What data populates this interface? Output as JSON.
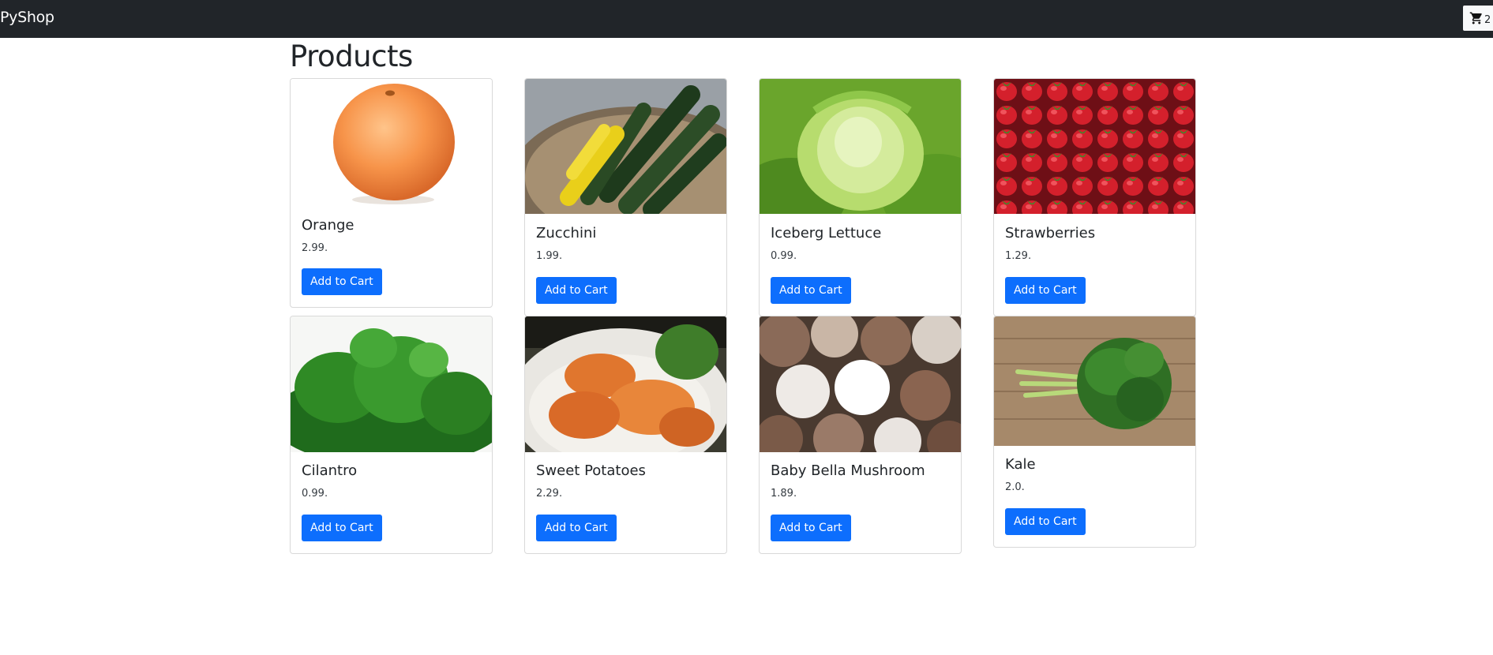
{
  "navbar": {
    "brand": "PyShop",
    "cart_icon": "cart-icon",
    "cart_count": "2"
  },
  "page": {
    "title": "Products"
  },
  "products": [
    {
      "name": "Orange",
      "price": "2.99.",
      "button": "Add to Cart",
      "image": "orange-image"
    },
    {
      "name": "Zucchini",
      "price": "1.99.",
      "button": "Add to Cart",
      "image": "zucchini-image"
    },
    {
      "name": "Iceberg Lettuce",
      "price": "0.99.",
      "button": "Add to Cart",
      "image": "lettuce-image"
    },
    {
      "name": "Strawberries",
      "price": "1.29.",
      "button": "Add to Cart",
      "image": "strawberries-image"
    },
    {
      "name": "Cilantro",
      "price": "0.99.",
      "button": "Add to Cart",
      "image": "cilantro-image"
    },
    {
      "name": "Sweet Potatoes",
      "price": "2.29.",
      "button": "Add to Cart",
      "image": "sweet-potatoes-image"
    },
    {
      "name": "Baby Bella Mushroom",
      "price": "1.89.",
      "button": "Add to Cart",
      "image": "mushroom-image"
    },
    {
      "name": "Kale",
      "price": "2.0.",
      "button": "Add to Cart",
      "image": "kale-image"
    }
  ],
  "colors": {
    "navbar_bg": "#212529",
    "primary_button": "#0d6efd",
    "card_border": "#d9d9d9"
  }
}
